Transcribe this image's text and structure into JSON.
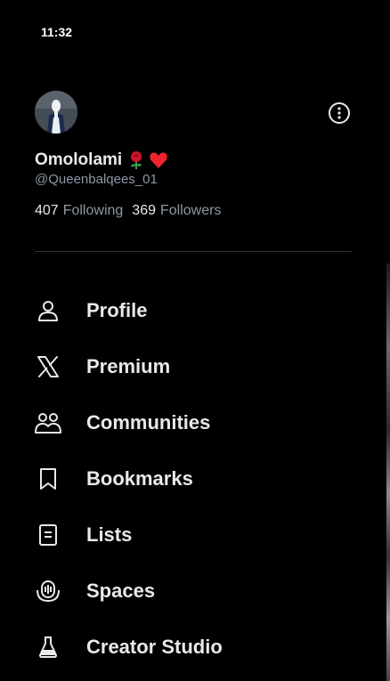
{
  "status_bar": {
    "time": "11:32"
  },
  "profile": {
    "display_name": "Omololami",
    "emojis": [
      "rose-emoji",
      "heart-emoji"
    ],
    "handle": "@Queenbalqees_01",
    "following_count": "407",
    "following_label": "Following",
    "followers_count": "369",
    "followers_label": "Followers"
  },
  "nav": {
    "items": [
      {
        "label": "Profile",
        "icon": "person-icon"
      },
      {
        "label": "Premium",
        "icon": "x-logo-icon"
      },
      {
        "label": "Communities",
        "icon": "communities-icon"
      },
      {
        "label": "Bookmarks",
        "icon": "bookmark-icon"
      },
      {
        "label": "Lists",
        "icon": "lists-icon"
      },
      {
        "label": "Spaces",
        "icon": "spaces-icon"
      },
      {
        "label": "Creator Studio",
        "icon": "creator-studio-icon"
      }
    ]
  },
  "colors": {
    "background": "#000000",
    "primary_text": "#e7e9ea",
    "secondary_text": "#8b98a5",
    "divider": "#2f3336"
  }
}
